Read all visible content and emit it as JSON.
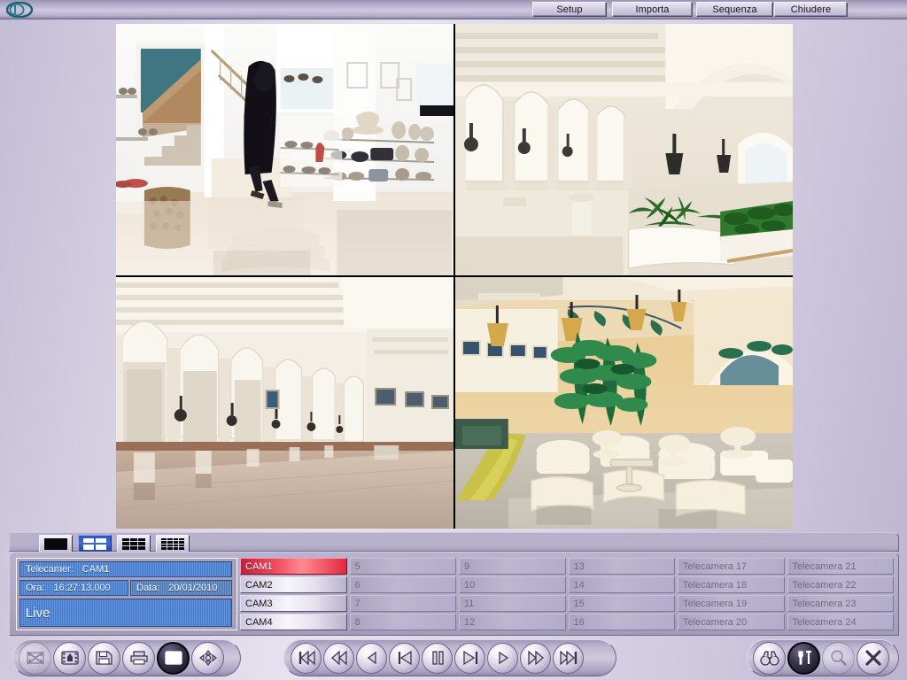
{
  "app": {
    "logo_icon": "letter-d-logo",
    "title": ""
  },
  "topbar": {
    "buttons": [
      {
        "label": "Setup",
        "name": "setup-button"
      },
      {
        "label": "Importa",
        "name": "importa-button"
      },
      {
        "label": "Sequenza",
        "name": "sequenza-button"
      },
      {
        "label": "Chiudere",
        "name": "chiudere-button"
      }
    ]
  },
  "video_grid": {
    "layout": "2x2",
    "cells": [
      {
        "camera": "CAM1",
        "scene": "retail-shoe-store-staircase"
      },
      {
        "camera": "CAM2",
        "scene": "hotel-arcade-courtyard-palms"
      },
      {
        "camera": "CAM3",
        "scene": "white-arched-corridor"
      },
      {
        "camera": "CAM4",
        "scene": "hotel-lobby-lounge-plants"
      }
    ]
  },
  "layout_buttons": [
    {
      "name": "layout-1x1",
      "icon": "grid-1-icon",
      "selected": false
    },
    {
      "name": "layout-2x2",
      "icon": "grid-4-icon",
      "selected": true
    },
    {
      "name": "layout-3x3",
      "icon": "grid-9-icon",
      "selected": false
    },
    {
      "name": "layout-4x4",
      "icon": "grid-16-icon",
      "selected": false
    }
  ],
  "info_panel": {
    "camera_label": "Telecamer:",
    "camera_value": "CAM1",
    "time_label": "Ora:",
    "time_value": "16:27:13.000",
    "date_label": "Data:",
    "date_value": "20/01/2010",
    "mode": "Live",
    "lcd_color": "#4a7fd0"
  },
  "cameras": [
    {
      "label": "CAM1",
      "state": "active"
    },
    {
      "label": "CAM2",
      "state": "normal"
    },
    {
      "label": "CAM3",
      "state": "normal"
    },
    {
      "label": "CAM4",
      "state": "normal"
    },
    {
      "label": "5",
      "state": "dim"
    },
    {
      "label": "6",
      "state": "dim"
    },
    {
      "label": "7",
      "state": "dim"
    },
    {
      "label": "8",
      "state": "dim"
    },
    {
      "label": "9",
      "state": "dim"
    },
    {
      "label": "10",
      "state": "dim"
    },
    {
      "label": "11",
      "state": "dim"
    },
    {
      "label": "12",
      "state": "dim"
    },
    {
      "label": "13",
      "state": "dim"
    },
    {
      "label": "14",
      "state": "dim"
    },
    {
      "label": "15",
      "state": "dim"
    },
    {
      "label": "16",
      "state": "dim"
    },
    {
      "label": "Telecamera 17",
      "state": "dim"
    },
    {
      "label": "Telecamera 18",
      "state": "dim"
    },
    {
      "label": "Telecamera 19",
      "state": "dim"
    },
    {
      "label": "Telecamera 20",
      "state": "dim"
    },
    {
      "label": "Telecamera 21",
      "state": "dim"
    },
    {
      "label": "Telecamera 22",
      "state": "dim"
    },
    {
      "label": "Telecamera 23",
      "state": "dim"
    },
    {
      "label": "Telecamera 24",
      "state": "dim"
    }
  ],
  "left_tools": [
    {
      "name": "record-off-button",
      "icon": "film-crossed-icon",
      "state": "disabled"
    },
    {
      "name": "export-clip-button",
      "icon": "film-export-icon",
      "state": "normal"
    },
    {
      "name": "save-button",
      "icon": "floppy-save-icon",
      "state": "normal"
    },
    {
      "name": "print-button",
      "icon": "printer-icon",
      "state": "normal"
    },
    {
      "name": "video-mode-button",
      "icon": "film-strip-icon",
      "state": "active"
    },
    {
      "name": "pan-tilt-button",
      "icon": "move-arrows-icon",
      "state": "normal"
    }
  ],
  "transport": [
    {
      "name": "skip-start-button",
      "icon": "skip-backward-icon"
    },
    {
      "name": "rewind-button",
      "icon": "rewind-icon"
    },
    {
      "name": "step-back-button",
      "icon": "play-back-icon"
    },
    {
      "name": "prev-frame-button",
      "icon": "prev-frame-icon"
    },
    {
      "name": "pause-button",
      "icon": "pause-icon"
    },
    {
      "name": "next-frame-button",
      "icon": "next-frame-icon"
    },
    {
      "name": "play-button",
      "icon": "play-icon"
    },
    {
      "name": "fast-forward-button",
      "icon": "fast-forward-icon"
    },
    {
      "name": "skip-end-button",
      "icon": "skip-forward-icon"
    }
  ],
  "right_tools": [
    {
      "name": "search-archive-button",
      "icon": "binoculars-icon",
      "state": "normal"
    },
    {
      "name": "tools-button",
      "icon": "tools-icon",
      "state": "active"
    },
    {
      "name": "zoom-button",
      "icon": "magnifier-icon",
      "state": "disabled"
    },
    {
      "name": "close-button",
      "icon": "x-close-icon",
      "state": "normal"
    }
  ]
}
